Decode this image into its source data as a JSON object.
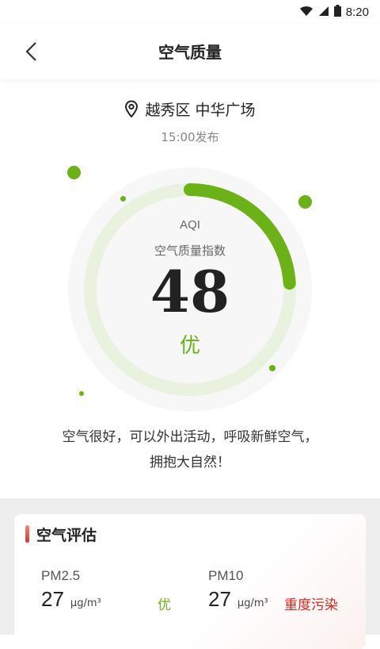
{
  "status_bar": {
    "time": "8:20"
  },
  "header": {
    "title": "空气质量"
  },
  "location": {
    "name": "越秀区 中华广场",
    "publish_time": "15:00发布"
  },
  "aqi": {
    "label": "AQI",
    "sublabel": "空气质量指数",
    "value": "48",
    "level": "优",
    "gauge_fraction": 0.24,
    "color": "#6ab215",
    "track_color": "#e9f2df"
  },
  "advice": {
    "line1": "空气很好，可以外出活动，呼吸新鲜空气，",
    "line2": "拥抱大自然！"
  },
  "assessment": {
    "title": "空气评估",
    "items": [
      {
        "name": "PM2.5",
        "value": "27",
        "unit": "μg/m³",
        "level": "优",
        "level_color": "#6ab215"
      },
      {
        "name": "PM10",
        "value": "27",
        "unit": "μg/m³",
        "level": "重度污染",
        "level_color": "#d9261c"
      }
    ]
  }
}
